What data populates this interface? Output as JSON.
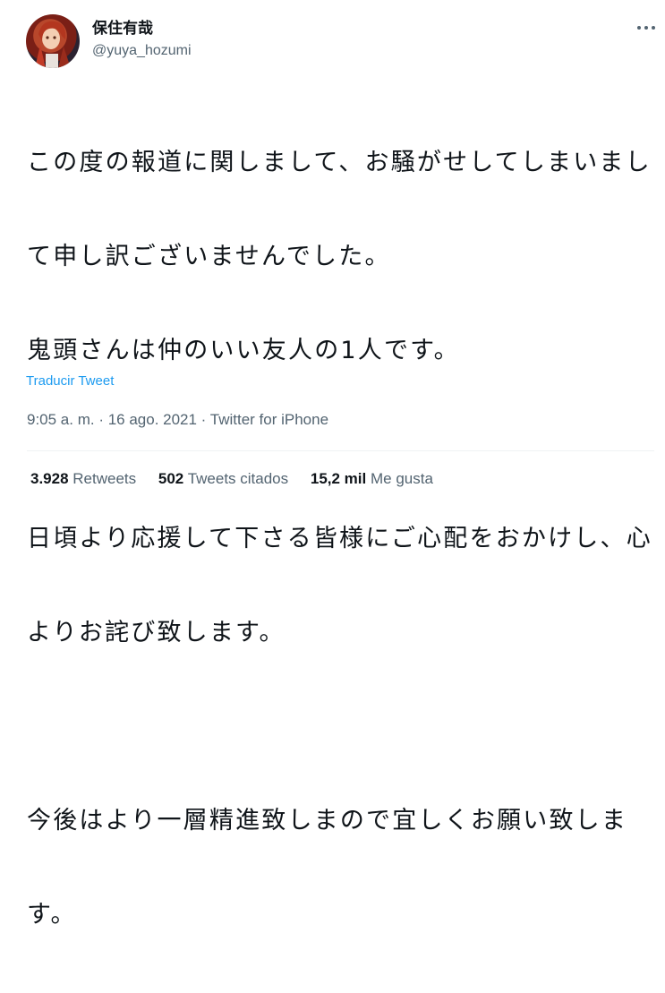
{
  "author": {
    "name": "保住有哉",
    "handle": "@yuya_hozumi",
    "avatar_icon": "profile-avatar"
  },
  "more_icon": "more-options-icon",
  "tweet_lines": [
    "この度の報道に関しまして、お騒がせしてしまいまし",
    "て申し訳ございませんでした。",
    "鬼頭さんは仲のいい友人の1人です。",
    "",
    "日頃より応援して下さる皆様にご心配をおかけし、心",
    "よりお詫び致します。",
    "",
    "今後はより一層精進致しまので宜しくお願い致しま",
    "す。"
  ],
  "translate_label": "Traducir Tweet",
  "timestamp": "9:05 a. m. · 16 ago. 2021 · ",
  "source_app": "Twitter for iPhone",
  "stats": {
    "retweets_count": "3.928",
    "retweets_label": "Retweets",
    "quotes_count": "502",
    "quotes_label": "Tweets citados",
    "likes_count": "15,2 mil",
    "likes_label": "Me gusta"
  },
  "colors": {
    "link": "#1d9bf0",
    "secondary_text": "#536471",
    "primary_text": "#0f1419"
  }
}
